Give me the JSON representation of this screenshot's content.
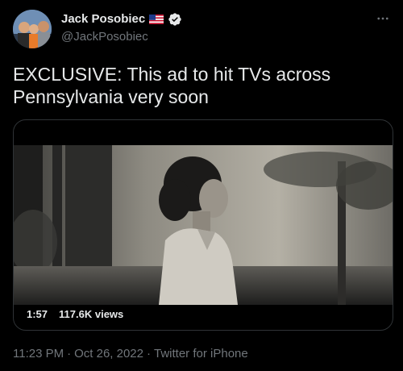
{
  "author": {
    "display_name": "Jack Posobiec",
    "handle": "@JackPosobiec",
    "flag_icon": "us-flag-icon",
    "verified_icon": "verified-badge-icon"
  },
  "tweet": {
    "text": "EXCLUSIVE: This ad to hit TVs across Pennsylvania very soon"
  },
  "media": {
    "type": "video",
    "duration": "1:57",
    "views": "117.6K views"
  },
  "footer": {
    "time": "11:23 PM",
    "separator_1": "·",
    "date": "Oct 26, 2022",
    "separator_2": "·",
    "source": "Twitter for iPhone"
  },
  "colors": {
    "background": "#000000",
    "text_primary": "#e7e9ea",
    "text_secondary": "#71767b",
    "verified": "#e7e9ea"
  }
}
